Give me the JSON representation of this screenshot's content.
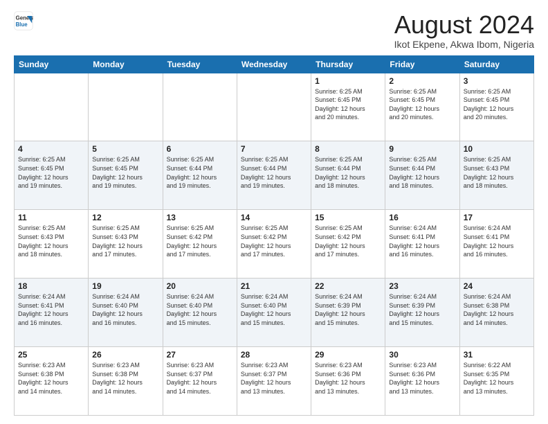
{
  "header": {
    "logo_line1": "General",
    "logo_line2": "Blue",
    "main_title": "August 2024",
    "subtitle": "Ikot Ekpene, Akwa Ibom, Nigeria"
  },
  "weekdays": [
    "Sunday",
    "Monday",
    "Tuesday",
    "Wednesday",
    "Thursday",
    "Friday",
    "Saturday"
  ],
  "weeks": [
    [
      {
        "day": "",
        "info": ""
      },
      {
        "day": "",
        "info": ""
      },
      {
        "day": "",
        "info": ""
      },
      {
        "day": "",
        "info": ""
      },
      {
        "day": "1",
        "info": "Sunrise: 6:25 AM\nSunset: 6:45 PM\nDaylight: 12 hours\nand 20 minutes."
      },
      {
        "day": "2",
        "info": "Sunrise: 6:25 AM\nSunset: 6:45 PM\nDaylight: 12 hours\nand 20 minutes."
      },
      {
        "day": "3",
        "info": "Sunrise: 6:25 AM\nSunset: 6:45 PM\nDaylight: 12 hours\nand 20 minutes."
      }
    ],
    [
      {
        "day": "4",
        "info": "Sunrise: 6:25 AM\nSunset: 6:45 PM\nDaylight: 12 hours\nand 19 minutes."
      },
      {
        "day": "5",
        "info": "Sunrise: 6:25 AM\nSunset: 6:45 PM\nDaylight: 12 hours\nand 19 minutes."
      },
      {
        "day": "6",
        "info": "Sunrise: 6:25 AM\nSunset: 6:44 PM\nDaylight: 12 hours\nand 19 minutes."
      },
      {
        "day": "7",
        "info": "Sunrise: 6:25 AM\nSunset: 6:44 PM\nDaylight: 12 hours\nand 19 minutes."
      },
      {
        "day": "8",
        "info": "Sunrise: 6:25 AM\nSunset: 6:44 PM\nDaylight: 12 hours\nand 18 minutes."
      },
      {
        "day": "9",
        "info": "Sunrise: 6:25 AM\nSunset: 6:44 PM\nDaylight: 12 hours\nand 18 minutes."
      },
      {
        "day": "10",
        "info": "Sunrise: 6:25 AM\nSunset: 6:43 PM\nDaylight: 12 hours\nand 18 minutes."
      }
    ],
    [
      {
        "day": "11",
        "info": "Sunrise: 6:25 AM\nSunset: 6:43 PM\nDaylight: 12 hours\nand 18 minutes."
      },
      {
        "day": "12",
        "info": "Sunrise: 6:25 AM\nSunset: 6:43 PM\nDaylight: 12 hours\nand 17 minutes."
      },
      {
        "day": "13",
        "info": "Sunrise: 6:25 AM\nSunset: 6:42 PM\nDaylight: 12 hours\nand 17 minutes."
      },
      {
        "day": "14",
        "info": "Sunrise: 6:25 AM\nSunset: 6:42 PM\nDaylight: 12 hours\nand 17 minutes."
      },
      {
        "day": "15",
        "info": "Sunrise: 6:25 AM\nSunset: 6:42 PM\nDaylight: 12 hours\nand 17 minutes."
      },
      {
        "day": "16",
        "info": "Sunrise: 6:24 AM\nSunset: 6:41 PM\nDaylight: 12 hours\nand 16 minutes."
      },
      {
        "day": "17",
        "info": "Sunrise: 6:24 AM\nSunset: 6:41 PM\nDaylight: 12 hours\nand 16 minutes."
      }
    ],
    [
      {
        "day": "18",
        "info": "Sunrise: 6:24 AM\nSunset: 6:41 PM\nDaylight: 12 hours\nand 16 minutes."
      },
      {
        "day": "19",
        "info": "Sunrise: 6:24 AM\nSunset: 6:40 PM\nDaylight: 12 hours\nand 16 minutes."
      },
      {
        "day": "20",
        "info": "Sunrise: 6:24 AM\nSunset: 6:40 PM\nDaylight: 12 hours\nand 15 minutes."
      },
      {
        "day": "21",
        "info": "Sunrise: 6:24 AM\nSunset: 6:40 PM\nDaylight: 12 hours\nand 15 minutes."
      },
      {
        "day": "22",
        "info": "Sunrise: 6:24 AM\nSunset: 6:39 PM\nDaylight: 12 hours\nand 15 minutes."
      },
      {
        "day": "23",
        "info": "Sunrise: 6:24 AM\nSunset: 6:39 PM\nDaylight: 12 hours\nand 15 minutes."
      },
      {
        "day": "24",
        "info": "Sunrise: 6:24 AM\nSunset: 6:38 PM\nDaylight: 12 hours\nand 14 minutes."
      }
    ],
    [
      {
        "day": "25",
        "info": "Sunrise: 6:23 AM\nSunset: 6:38 PM\nDaylight: 12 hours\nand 14 minutes."
      },
      {
        "day": "26",
        "info": "Sunrise: 6:23 AM\nSunset: 6:38 PM\nDaylight: 12 hours\nand 14 minutes."
      },
      {
        "day": "27",
        "info": "Sunrise: 6:23 AM\nSunset: 6:37 PM\nDaylight: 12 hours\nand 14 minutes."
      },
      {
        "day": "28",
        "info": "Sunrise: 6:23 AM\nSunset: 6:37 PM\nDaylight: 12 hours\nand 13 minutes."
      },
      {
        "day": "29",
        "info": "Sunrise: 6:23 AM\nSunset: 6:36 PM\nDaylight: 12 hours\nand 13 minutes."
      },
      {
        "day": "30",
        "info": "Sunrise: 6:23 AM\nSunset: 6:36 PM\nDaylight: 12 hours\nand 13 minutes."
      },
      {
        "day": "31",
        "info": "Sunrise: 6:22 AM\nSunset: 6:35 PM\nDaylight: 12 hours\nand 13 minutes."
      }
    ]
  ]
}
